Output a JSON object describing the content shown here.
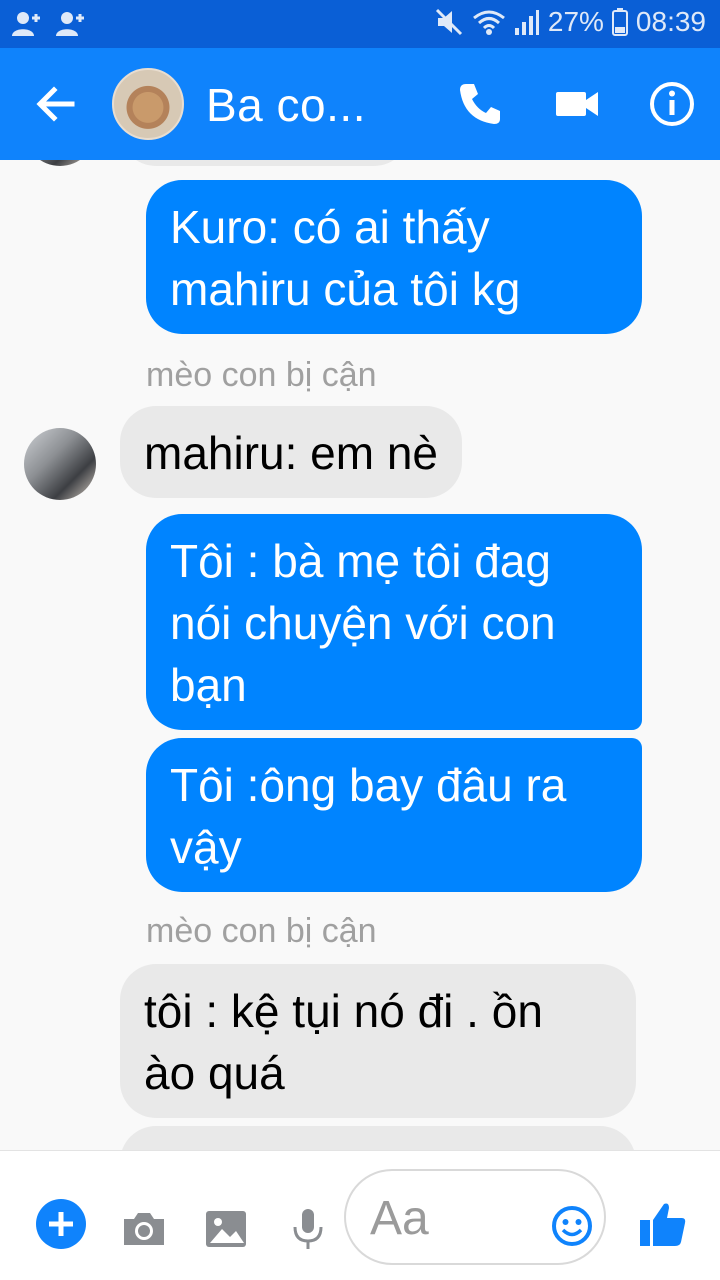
{
  "status_bar": {
    "battery": "27%",
    "time": "08:39"
  },
  "header": {
    "title": "Ba co..."
  },
  "messages": [
    {
      "type": "outgoing",
      "text": "Kuro: có ai thấy\nmahiru của tôi kg"
    },
    {
      "type": "sender",
      "text": "mèo con bị cận"
    },
    {
      "type": "incoming",
      "text": "mahiru: em nè"
    },
    {
      "type": "outgoing",
      "text": "Tôi : bà mẹ tôi đag\nnói chuyện với con\nbạn"
    },
    {
      "type": "outgoing",
      "text": "Tôi :ông bay đâu ra\nvậy"
    },
    {
      "type": "sender",
      "text": "mèo con bị cận"
    },
    {
      "type": "incoming",
      "text": "tôi : kệ tụi nó đi . ồn\nào quá"
    }
  ],
  "composer": {
    "placeholder": "Aa"
  },
  "colors": {
    "accent": "#0f83fc",
    "outgoing_bubble": "#0084ff",
    "incoming_bubble": "#e9e9e9",
    "status_bar": "#0a5fd6"
  },
  "icons": [
    "add-person-icon",
    "mute-icon",
    "wifi-icon",
    "signal-icon",
    "battery-icon",
    "back-arrow-icon",
    "phone-icon",
    "video-camera-icon",
    "info-icon",
    "plus-icon",
    "camera-icon",
    "image-icon",
    "microphone-icon",
    "emoji-icon",
    "thumbs-up-icon"
  ]
}
